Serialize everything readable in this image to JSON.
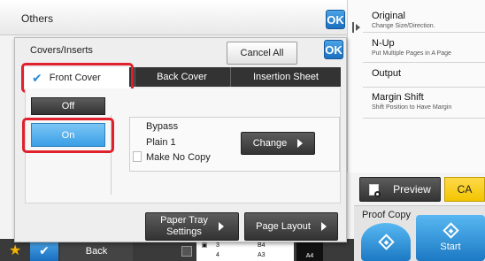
{
  "top": {
    "title": "Others",
    "ok": "OK"
  },
  "right_menu": [
    {
      "title": "Original",
      "sub": "Change Size/Direction."
    },
    {
      "title": "N-Up",
      "sub": "Put Multiple Pages in A Page"
    },
    {
      "title": "Output",
      "sub": ""
    },
    {
      "title": "Margin Shift",
      "sub": "Shift Position to Have Margin"
    }
  ],
  "modal": {
    "title": "Covers/Inserts",
    "cancel_all": "Cancel All",
    "ok": "OK",
    "tabs": [
      "Front Cover",
      "Back Cover",
      "Insertion Sheet"
    ],
    "off": "Off",
    "on": "On",
    "bypass": "Bypass",
    "paper": "Plain 1",
    "no_copy": "Make No Copy",
    "change": "Change",
    "paper_tray": "Paper Tray\nSettings",
    "page_layout": "Page Layout"
  },
  "actions": {
    "preview": "Preview",
    "ca": "CA",
    "proof_copy": "Proof Copy",
    "start": "Start"
  },
  "bottom": {
    "back": "Back",
    "tray_rows": [
      [
        "3",
        "B4"
      ],
      [
        "4",
        "A3"
      ]
    ],
    "paper_size": "A4"
  },
  "colors": {
    "accent_blue": "#1a6fc0",
    "highlight_red": "#e0202d",
    "ca_yellow": "#f2c500"
  }
}
